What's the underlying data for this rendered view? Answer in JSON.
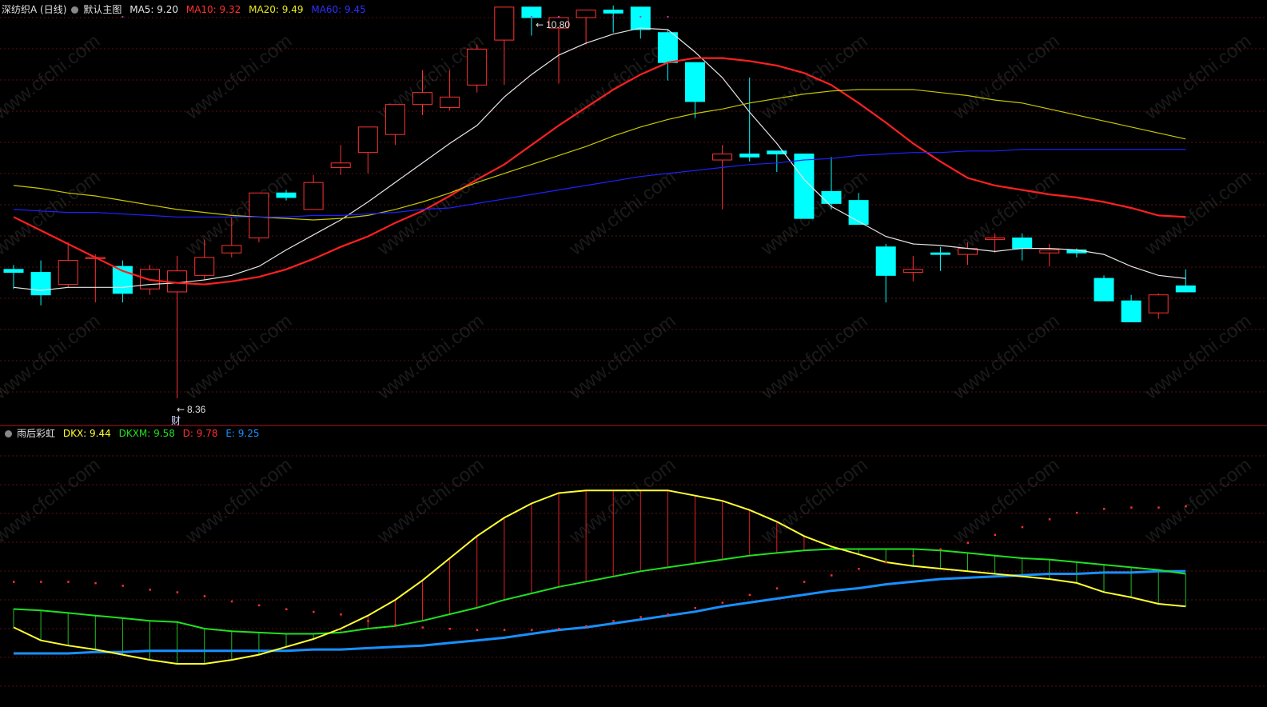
{
  "main_header": {
    "stock": "深纺织A (日线)",
    "chart_name": "默认主图",
    "ma5_label": "MA5: 9.20",
    "ma10_label": "MA10: 9.32",
    "ma20_label": "MA20: 9.49",
    "ma60_label": "MA60: 9.45"
  },
  "sub_header": {
    "indicator": "雨后彩虹",
    "dkx_label": "DKX: 9.44",
    "dkxm_label": "DKXM: 9.58",
    "d_label": "D: 9.78",
    "e_label": "E: 9.25"
  },
  "annotations": {
    "high": "10.80",
    "low": "8.36",
    "finance_marker": "财"
  },
  "watermark": "www.cfchi.com",
  "colors": {
    "up": "#ff3232",
    "down": "#00ffff",
    "ma5": "#e6e6e6",
    "ma10": "#ff2020",
    "ma20": "#c8c800",
    "ma60": "#2020ff",
    "dkx": "#ffff30",
    "dkxm": "#20e020",
    "e_line": "#1890ff",
    "d_dots": "#ff3030"
  },
  "chart_data": [
    {
      "type": "candlestick",
      "title": "深纺织A (日线)",
      "ylim": [
        8.2,
        10.9
      ],
      "ohlc": [
        [
          9.22,
          9.25,
          9.09,
          9.2
        ],
        [
          9.2,
          9.28,
          8.98,
          9.05
        ],
        [
          9.12,
          9.4,
          9.1,
          9.28
        ],
        [
          9.3,
          9.32,
          9.0,
          9.3
        ],
        [
          9.24,
          9.28,
          9.0,
          9.06
        ],
        [
          9.09,
          9.25,
          9.05,
          9.22
        ],
        [
          9.07,
          9.31,
          8.36,
          9.21
        ],
        [
          9.18,
          9.42,
          9.15,
          9.3
        ],
        [
          9.33,
          9.57,
          9.3,
          9.38
        ],
        [
          9.43,
          9.73,
          9.4,
          9.73
        ],
        [
          9.73,
          9.75,
          9.68,
          9.7
        ],
        [
          9.62,
          9.85,
          9.62,
          9.8
        ],
        [
          9.9,
          10.05,
          9.85,
          9.93
        ],
        [
          10.0,
          10.12,
          9.86,
          10.17
        ],
        [
          10.12,
          10.32,
          10.05,
          10.32
        ],
        [
          10.32,
          10.55,
          10.25,
          10.4
        ],
        [
          10.3,
          10.55,
          10.28,
          10.37
        ],
        [
          10.45,
          10.72,
          10.4,
          10.69
        ],
        [
          10.75,
          10.79,
          10.45,
          10.97
        ],
        [
          10.97,
          10.8,
          10.78,
          10.9
        ],
        [
          10.83,
          10.9,
          10.46,
          10.9
        ],
        [
          10.9,
          10.93,
          10.72,
          10.95
        ],
        [
          10.95,
          10.98,
          10.8,
          10.93
        ],
        [
          10.97,
          10.96,
          10.76,
          10.82
        ],
        [
          10.8,
          10.82,
          10.48,
          10.6
        ],
        [
          10.6,
          10.6,
          10.23,
          10.34
        ],
        [
          9.95,
          10.05,
          9.62,
          9.99
        ],
        [
          9.99,
          10.5,
          9.94,
          9.97
        ],
        [
          10.01,
          10.01,
          9.87,
          9.99
        ],
        [
          9.99,
          9.96,
          9.56,
          9.56
        ],
        [
          9.74,
          9.97,
          9.62,
          9.66
        ],
        [
          9.68,
          9.73,
          9.52,
          9.52
        ],
        [
          9.37,
          9.39,
          9.0,
          9.18
        ],
        [
          9.2,
          9.31,
          9.14,
          9.22
        ],
        [
          9.33,
          9.37,
          9.21,
          9.32
        ],
        [
          9.32,
          9.4,
          9.25,
          9.36
        ],
        [
          9.42,
          9.46,
          9.33,
          9.43
        ],
        [
          9.43,
          9.46,
          9.28,
          9.36
        ],
        [
          9.33,
          9.39,
          9.24,
          9.35
        ],
        [
          9.35,
          9.36,
          9.3,
          9.33
        ],
        [
          9.16,
          9.18,
          9.05,
          9.01
        ],
        [
          9.01,
          9.05,
          8.94,
          8.87
        ],
        [
          8.93,
          9.06,
          8.89,
          9.05
        ],
        [
          9.11,
          9.22,
          9.08,
          9.07
        ]
      ],
      "series": [
        {
          "name": "MA5",
          "values": [
            9.1,
            9.08,
            9.1,
            9.1,
            9.1,
            9.12,
            9.13,
            9.15,
            9.18,
            9.24,
            9.35,
            9.45,
            9.55,
            9.67,
            9.8,
            9.93,
            10.06,
            10.18,
            10.37,
            10.52,
            10.65,
            10.73,
            10.79,
            10.83,
            10.82,
            10.67,
            10.5,
            10.27,
            10.06,
            9.82,
            9.64,
            9.54,
            9.44,
            9.39,
            9.38,
            9.36,
            9.34,
            9.36,
            9.36,
            9.35,
            9.32,
            9.24,
            9.18,
            9.16
          ]
        },
        {
          "name": "MA10",
          "values": [
            9.57,
            9.48,
            9.39,
            9.3,
            9.21,
            9.15,
            9.13,
            9.12,
            9.14,
            9.17,
            9.22,
            9.29,
            9.37,
            9.44,
            9.53,
            9.61,
            9.71,
            9.82,
            9.92,
            10.05,
            10.18,
            10.3,
            10.42,
            10.52,
            10.6,
            10.63,
            10.63,
            10.61,
            10.58,
            10.53,
            10.45,
            10.33,
            10.2,
            10.06,
            9.94,
            9.83,
            9.78,
            9.75,
            9.72,
            9.7,
            9.67,
            9.63,
            9.58,
            9.57
          ]
        },
        {
          "name": "MA20",
          "values": [
            9.78,
            9.76,
            9.73,
            9.71,
            9.68,
            9.65,
            9.62,
            9.6,
            9.58,
            9.57,
            9.56,
            9.55,
            9.56,
            9.58,
            9.62,
            9.67,
            9.73,
            9.8,
            9.86,
            9.92,
            9.98,
            10.04,
            10.11,
            10.17,
            10.22,
            10.26,
            10.29,
            10.33,
            10.36,
            10.39,
            10.41,
            10.42,
            10.42,
            10.42,
            10.4,
            10.38,
            10.35,
            10.33,
            10.29,
            10.25,
            10.21,
            10.17,
            10.13,
            10.09
          ]
        },
        {
          "name": "MA60",
          "values": [
            9.62,
            9.61,
            9.6,
            9.6,
            9.59,
            9.58,
            9.57,
            9.57,
            9.57,
            9.57,
            9.57,
            9.58,
            9.58,
            9.59,
            9.6,
            9.62,
            9.63,
            9.66,
            9.69,
            9.72,
            9.75,
            9.78,
            9.81,
            9.84,
            9.86,
            9.88,
            9.9,
            9.92,
            9.93,
            9.95,
            9.96,
            9.98,
            9.99,
            10.0,
            10.0,
            10.01,
            10.01,
            10.02,
            10.02,
            10.02,
            10.02,
            10.02,
            10.02,
            10.02
          ]
        }
      ]
    },
    {
      "type": "line",
      "title": "雨后彩虹",
      "ylim": [
        8.9,
        10.9
      ],
      "series": [
        {
          "name": "DKX",
          "values": [
            9.45,
            9.35,
            9.31,
            9.28,
            9.24,
            9.2,
            9.17,
            9.17,
            9.2,
            9.24,
            9.3,
            9.36,
            9.44,
            9.54,
            9.66,
            9.81,
            9.98,
            10.15,
            10.29,
            10.4,
            10.48,
            10.5,
            10.5,
            10.5,
            10.5,
            10.46,
            10.42,
            10.35,
            10.26,
            10.15,
            10.07,
            10.01,
            9.95,
            9.92,
            9.9,
            9.88,
            9.86,
            9.84,
            9.82,
            9.79,
            9.72,
            9.68,
            9.63,
            9.61
          ]
        },
        {
          "name": "DKXM",
          "values": [
            9.59,
            9.58,
            9.56,
            9.54,
            9.52,
            9.5,
            9.49,
            9.44,
            9.42,
            9.41,
            9.4,
            9.4,
            9.41,
            9.44,
            9.46,
            9.5,
            9.55,
            9.6,
            9.66,
            9.71,
            9.76,
            9.8,
            9.84,
            9.88,
            9.91,
            9.94,
            9.97,
            10.0,
            10.02,
            10.04,
            10.05,
            10.05,
            10.05,
            10.05,
            10.04,
            10.02,
            10.0,
            9.98,
            9.97,
            9.95,
            9.93,
            9.91,
            9.89,
            9.86
          ]
        },
        {
          "name": "D",
          "values": [
            9.8,
            9.8,
            9.8,
            9.79,
            9.77,
            9.74,
            9.72,
            9.69,
            9.65,
            9.62,
            9.59,
            9.57,
            9.55,
            9.5,
            9.47,
            9.45,
            9.44,
            9.43,
            9.43,
            9.43,
            9.44,
            9.46,
            9.5,
            9.53,
            9.55,
            9.6,
            9.64,
            9.7,
            9.75,
            9.8,
            9.85,
            9.9,
            9.95,
            10.0,
            10.05,
            10.1,
            10.16,
            10.22,
            10.28,
            10.33,
            10.36,
            10.37,
            10.37,
            10.38
          ]
        },
        {
          "name": "E",
          "values": [
            9.25,
            9.25,
            9.25,
            9.26,
            9.26,
            9.27,
            9.27,
            9.27,
            9.27,
            9.27,
            9.27,
            9.28,
            9.28,
            9.29,
            9.3,
            9.31,
            9.33,
            9.35,
            9.37,
            9.4,
            9.43,
            9.45,
            9.48,
            9.51,
            9.54,
            9.57,
            9.61,
            9.64,
            9.67,
            9.7,
            9.73,
            9.75,
            9.78,
            9.8,
            9.82,
            9.83,
            9.84,
            9.85,
            9.86,
            9.86,
            9.87,
            9.87,
            9.88,
            9.88
          ]
        }
      ]
    }
  ]
}
